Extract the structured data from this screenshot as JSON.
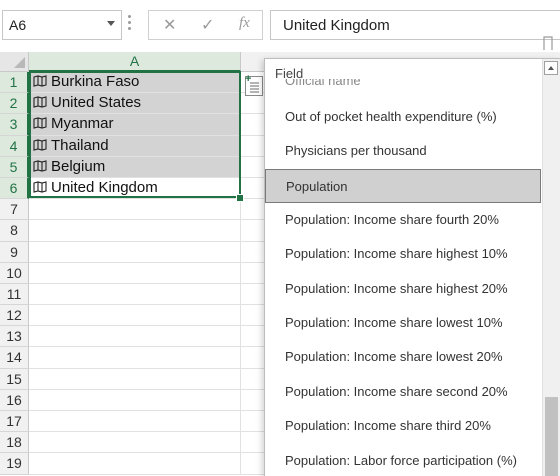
{
  "formula_bar": {
    "name_box": "A6",
    "cancel_icon": "✕",
    "enter_icon": "✓",
    "fx_label": "fx",
    "formula_value": "United Kingdom"
  },
  "grid": {
    "column_headers": [
      "A"
    ],
    "row_numbers": [
      "1",
      "2",
      "3",
      "4",
      "5",
      "6",
      "7",
      "8",
      "9",
      "10",
      "11",
      "12",
      "13",
      "14",
      "15",
      "16",
      "17",
      "18",
      "19"
    ],
    "cells": [
      "Burkina Faso",
      "United States",
      "Myanmar",
      "Thailand",
      "Belgium",
      "United Kingdom"
    ]
  },
  "field_panel": {
    "title": "Field",
    "partial_item": "Official name",
    "items": [
      "Out of pocket health expenditure (%)",
      "Physicians per thousand",
      "Population",
      "Population: Income share fourth 20%",
      "Population: Income share highest 10%",
      "Population: Income share highest 20%",
      "Population: Income share lowest 10%",
      "Population: Income share lowest 20%",
      "Population: Income share second 20%",
      "Population: Income share third 20%",
      "Population: Labor force participation (%)"
    ],
    "selected_item": "Population"
  },
  "colors": {
    "accent": "#217346",
    "selection_fill": "#d3d3d3"
  }
}
